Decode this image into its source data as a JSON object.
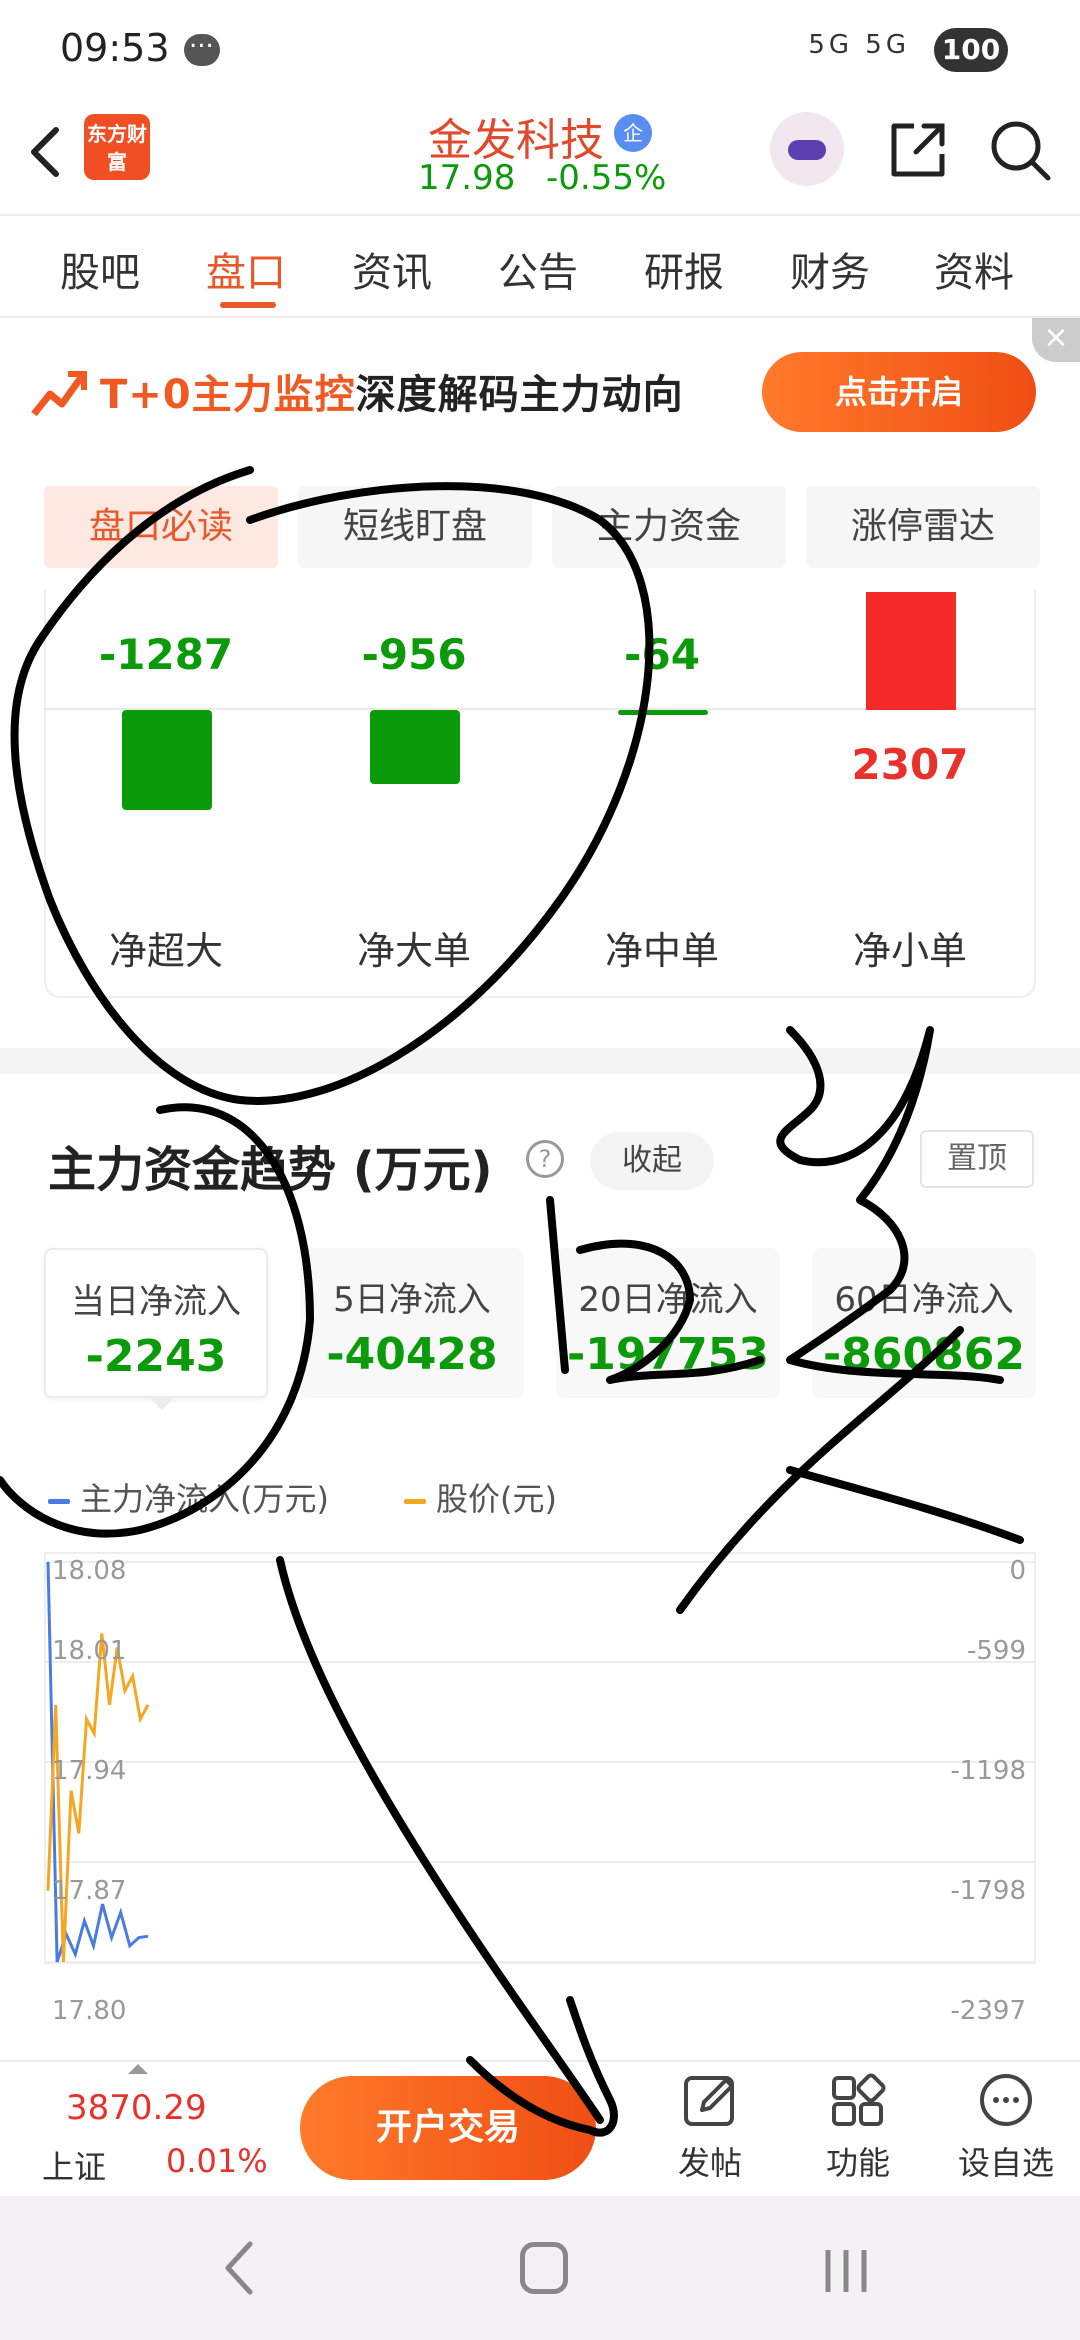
{
  "status_bar": {
    "time": "09:53",
    "network": "5G 5G",
    "battery": "100"
  },
  "header": {
    "logo_text": "东方财富",
    "stock_name": "金发科技",
    "badge": "企",
    "price": "17.98",
    "change": "-0.55%"
  },
  "tabs": [
    "股吧",
    "盘口",
    "资讯",
    "公告",
    "研报",
    "财务",
    "资料"
  ],
  "active_tab": "盘口",
  "banner": {
    "highlight": "T+0主力监控",
    "text": "深度解码主力动向",
    "button": "点击开启",
    "close": "×"
  },
  "subtabs": [
    "盘口必读",
    "短线盯盘",
    "主力资金",
    "涨停雷达"
  ],
  "flow": [
    {
      "label": "净超大",
      "value": "-1287"
    },
    {
      "label": "净大单",
      "value": "-956"
    },
    {
      "label": "净中单",
      "value": "-64"
    },
    {
      "label": "净小单",
      "value": "2307"
    }
  ],
  "trend": {
    "title": "主力资金趋势 (万元)",
    "help": "?",
    "collapse": "收起",
    "pin": "置顶",
    "periods": [
      {
        "label": "当日净流入",
        "value": "-2243"
      },
      {
        "label": "5日净流入",
        "value": "-40428"
      },
      {
        "label": "20日净流入",
        "value": "-197753"
      },
      {
        "label": "60日净流入",
        "value": "-860862"
      }
    ]
  },
  "chart_data": {
    "type": "line",
    "series": [
      {
        "name": "主力净流入(万元)",
        "color": "#4a7be0",
        "axis": "right",
        "values": [
          0,
          -2397,
          -2230,
          -2350,
          -2150,
          -2300,
          -2050,
          -2250,
          -2100,
          -2300,
          -2250,
          -2243
        ]
      },
      {
        "name": "股价(元)",
        "color": "#f5a623",
        "axis": "left",
        "values": [
          17.85,
          17.98,
          17.8,
          17.92,
          17.89,
          17.97,
          17.96,
          18.03,
          17.98,
          18.02,
          17.99,
          18.0,
          17.97,
          17.98
        ]
      }
    ],
    "left_ticks": [
      "18.08",
      "18.01",
      "17.94",
      "17.87",
      "17.80"
    ],
    "right_ticks": [
      "0",
      "-599",
      "-1198",
      "-1798",
      "-2397"
    ],
    "left_ylim": [
      17.8,
      18.08
    ],
    "right_ylim": [
      -2397,
      0
    ],
    "grid": true,
    "legend_position": "top-left"
  },
  "bottom_bar": {
    "index_value": "3870.29",
    "index_name": "上证",
    "index_change": "0.01%",
    "open_account": "开户交易",
    "actions": [
      "发帖",
      "功能",
      "设自选"
    ]
  },
  "colors": {
    "accent": "#e8582a",
    "down": "#0a9a0a",
    "up": "#e8312a"
  }
}
